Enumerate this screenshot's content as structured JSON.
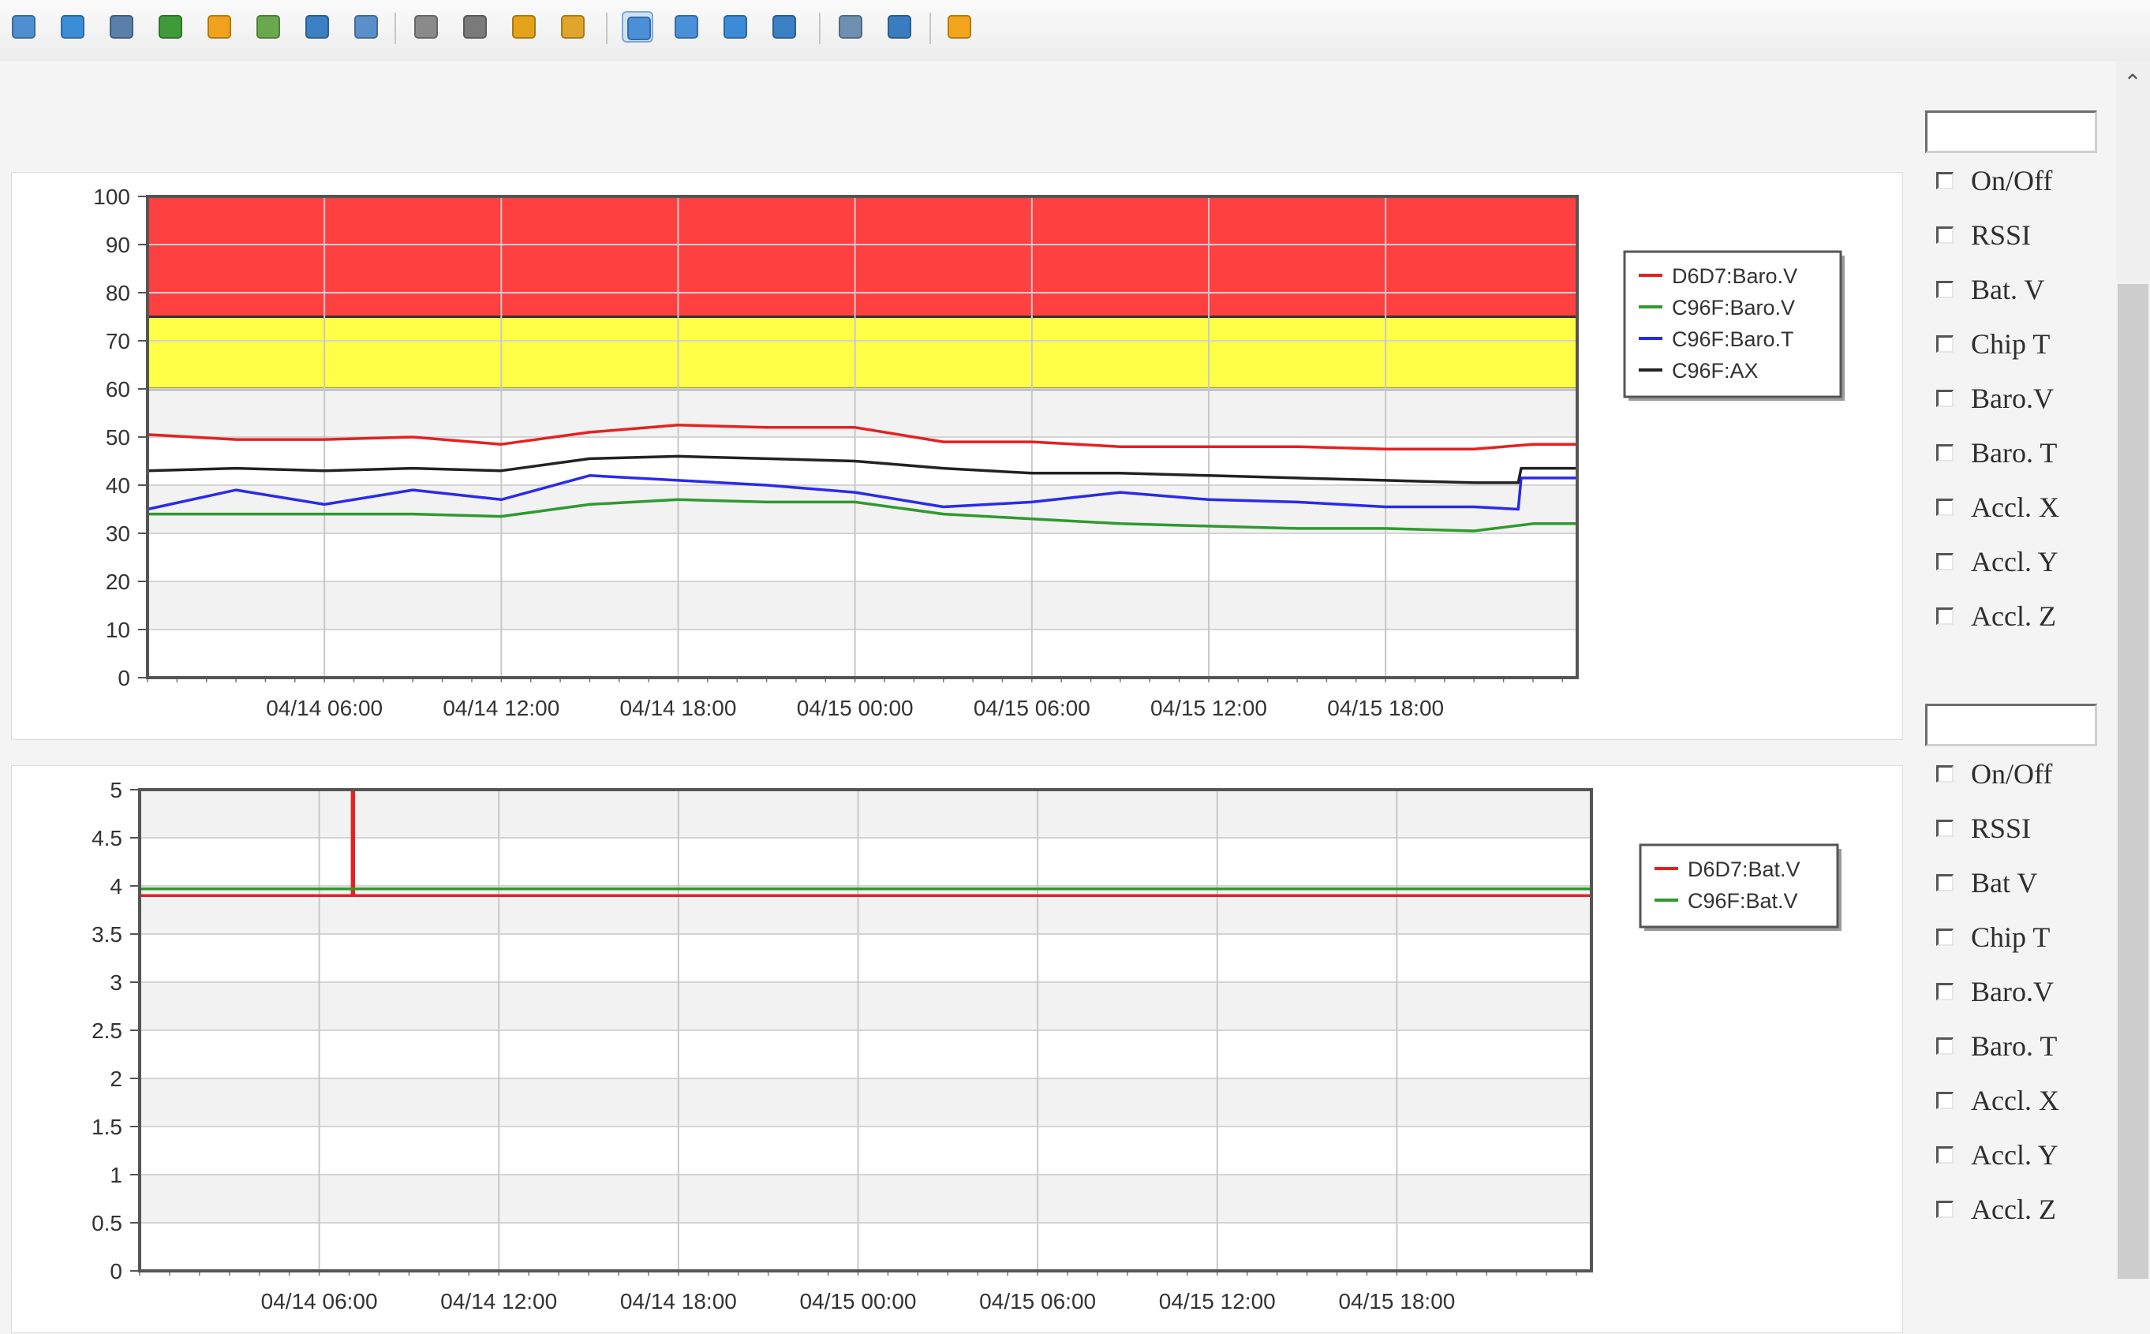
{
  "toolbar": {
    "buttons": [
      {
        "icon": "monitor-icon",
        "color": "#4f8fd1"
      },
      {
        "icon": "screen-icon",
        "color": "#3b8ed6"
      },
      {
        "icon": "terminal-icon",
        "color": "#5a7fa8"
      },
      {
        "icon": "arrows-icon",
        "color": "#3f9b3a"
      },
      {
        "icon": "warning-gear-icon",
        "color": "#f0a21d"
      },
      {
        "icon": "refresh-icon",
        "color": "#6aa84f"
      },
      {
        "icon": "phone-icon",
        "color": "#3c7fc2"
      },
      {
        "icon": "message-icon",
        "color": "#5b8fc9"
      },
      {
        "icon": "user-icon",
        "color": "#8a8a8a"
      },
      {
        "icon": "network-icon",
        "color": "#7a7a7a"
      },
      {
        "icon": "lock-icon",
        "color": "#e3a21a"
      },
      {
        "icon": "unlock-icon",
        "color": "#e0a52a"
      },
      {
        "icon": "window-icon",
        "color": "#4a90d9"
      },
      {
        "icon": "fullscreen-icon",
        "color": "#4a90d9"
      },
      {
        "icon": "layers-icon",
        "color": "#3c8bd6"
      },
      {
        "icon": "globe-icon",
        "color": "#3b7fc4"
      },
      {
        "icon": "copy-icon",
        "color": "#6f8fb0"
      },
      {
        "icon": "tools-icon",
        "color": "#3a7cc0"
      },
      {
        "icon": "close-icon",
        "color": "#f3a51c"
      }
    ]
  },
  "charts": [
    {
      "chart_data": {
        "type": "line",
        "x_tick_labels": [
          "04/14 06:00",
          "04/14 12:00",
          "04/14 18:00",
          "04/15 00:00",
          "04/15 06:00",
          "04/15 12:00",
          "04/15 18:00"
        ],
        "xlim": [
          -6,
          42.5
        ],
        "x_ticks": [
          0,
          6,
          12,
          18,
          24,
          30,
          36
        ],
        "ylim": [
          0,
          100
        ],
        "y_ticks": [
          0,
          10,
          20,
          30,
          40,
          50,
          60,
          70,
          80,
          90,
          100
        ],
        "bands": [
          {
            "from": 60,
            "to": 75,
            "color": "#ffff47"
          },
          {
            "from": 75,
            "to": 100,
            "color": "#ff4040"
          }
        ],
        "legend_position": "right",
        "series": [
          {
            "name": "D6D7:Baro.V",
            "color": "#e62020",
            "x": [
              -6,
              -3,
              0,
              3,
              6,
              9,
              12,
              15,
              18,
              21,
              24,
              27,
              30,
              33,
              36,
              39,
              41,
              42.5
            ],
            "y": [
              50.5,
              49.5,
              49.5,
              50,
              48.5,
              51,
              52.5,
              52,
              52,
              49,
              49,
              48,
              48,
              48,
              47.5,
              47.5,
              48.5,
              48.5
            ]
          },
          {
            "name": "C96F:Baro.V",
            "color": "#2e9a2e",
            "x": [
              -6,
              -3,
              0,
              3,
              6,
              9,
              12,
              15,
              18,
              21,
              24,
              27,
              30,
              33,
              36,
              39,
              41,
              42.5
            ],
            "y": [
              34,
              34,
              34,
              34,
              33.5,
              36,
              37,
              36.5,
              36.5,
              34,
              33,
              32,
              31.5,
              31,
              31,
              30.5,
              32,
              32
            ]
          },
          {
            "name": "C96F:Baro.T",
            "color": "#2a2aee",
            "x": [
              -6,
              -3,
              0,
              3,
              6,
              9,
              12,
              15,
              18,
              21,
              24,
              27,
              30,
              33,
              36,
              39,
              40.5,
              40.6,
              42.5
            ],
            "y": [
              35,
              39,
              36,
              39,
              37,
              42,
              41,
              40,
              38.5,
              35.5,
              36.5,
              38.5,
              37,
              36.5,
              35.5,
              35.5,
              35,
              41.5,
              41.5
            ]
          },
          {
            "name": "C96F:AX",
            "color": "#222222",
            "x": [
              -6,
              -3,
              0,
              3,
              6,
              9,
              12,
              15,
              18,
              21,
              24,
              27,
              30,
              33,
              36,
              39,
              40.5,
              40.6,
              42.5
            ],
            "y": [
              43,
              43.5,
              43,
              43.5,
              43,
              45.5,
              46,
              45.5,
              45,
              43.5,
              42.5,
              42.5,
              42,
              41.5,
              41,
              40.5,
              40.5,
              43.5,
              43.5
            ]
          }
        ]
      },
      "side": {
        "input_value": "",
        "checkboxes": [
          "On/Off",
          "RSSI",
          "Bat. V",
          "Chip T",
          "Baro.V",
          "Baro. T",
          "Accl. X",
          "Accl. Y",
          "Accl. Z"
        ]
      }
    },
    {
      "chart_data": {
        "type": "line",
        "x_tick_labels": [
          "04/14 06:00",
          "04/14 12:00",
          "04/14 18:00",
          "04/15 00:00",
          "04/15 06:00",
          "04/15 12:00",
          "04/15 18:00"
        ],
        "xlim": [
          -6,
          42.5
        ],
        "x_ticks": [
          0,
          6,
          12,
          18,
          24,
          30,
          36
        ],
        "ylim": [
          0,
          5
        ],
        "y_ticks": [
          0,
          0.5,
          1,
          1.5,
          2,
          2.5,
          3,
          3.5,
          4,
          4.5,
          5
        ],
        "legend_position": "right",
        "series": [
          {
            "name": "D6D7:Bat.V",
            "color": "#e62020",
            "x": [
              -6,
              1.1,
              1.1,
              1.15,
              1.15,
              42.5
            ],
            "y": [
              3.9,
              3.9,
              5,
              5,
              3.9,
              3.9
            ]
          },
          {
            "name": "C96F:Bat.V",
            "color": "#2e9a2e",
            "x": [
              -6,
              42.5
            ],
            "y": [
              3.97,
              3.97
            ]
          }
        ]
      },
      "side": {
        "input_value": "",
        "checkboxes": [
          "On/Off",
          "RSSI",
          "Bat V",
          "Chip T",
          "Baro.V",
          "Baro. T",
          "Accl. X",
          "Accl. Y",
          "Accl. Z"
        ]
      }
    }
  ]
}
